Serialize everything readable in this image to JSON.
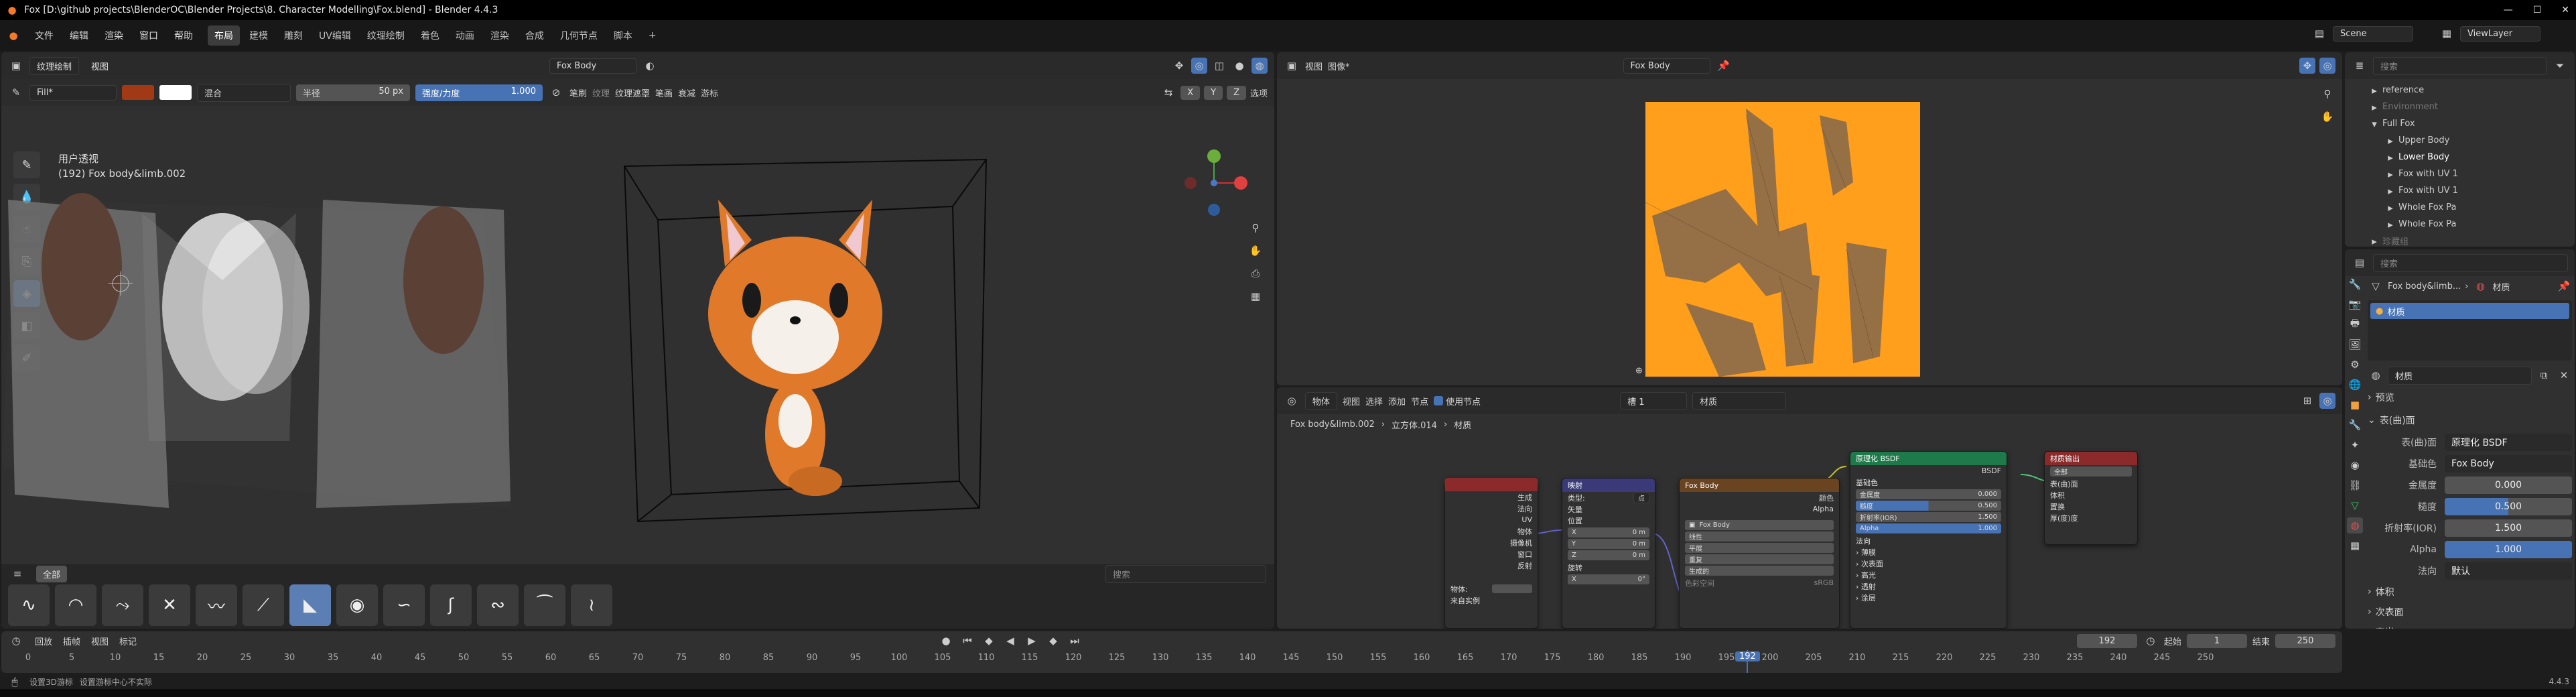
{
  "titlebar": {
    "title": "Fox [D:\\github projects\\BlenderOC\\Blender Projects\\8. Character Modelling\\Fox.blend] - Blender 4.4.3"
  },
  "menu": {
    "items": [
      "文件",
      "编辑",
      "渲染",
      "窗口",
      "帮助"
    ]
  },
  "workspaces": {
    "tabs": [
      "布局",
      "建模",
      "雕刻",
      "UV编辑",
      "纹理绘制",
      "着色",
      "动画",
      "渲染",
      "合成",
      "几何节点",
      "脚本"
    ],
    "active": "布局"
  },
  "top_right": {
    "scene": "Scene",
    "view_layer": "ViewLayer"
  },
  "viewport": {
    "header": {
      "mode": "纹理绘制",
      "view": "视图",
      "object": "Fox Body",
      "menus": [
        "纹理遮罩",
        "笔画",
        "衰减",
        "游标"
      ],
      "options": "选项"
    },
    "toolsettings": {
      "brush": "Fill*",
      "blend": "混合",
      "radius_label": "半径",
      "radius": "50 px",
      "strength_label": "强度/力度",
      "strength": "1.000",
      "brush_menu": "笔刷",
      "texture_menu": "纹理"
    },
    "overlay_text": {
      "view_name": "用户透视",
      "object_info": "(192) Fox body&limb.002"
    },
    "axes": [
      "X",
      "Y",
      "Z"
    ],
    "asset_shelf": {
      "tab": "全部",
      "search_placeholder": "搜索"
    },
    "object_label": "物体:",
    "object_value": "物体",
    "fix_label": "未自实例"
  },
  "image_editor": {
    "menus": [
      "视图",
      "图像*"
    ],
    "image": "Fox Body"
  },
  "node_editor": {
    "header": {
      "type": "物体",
      "menus": [
        "视图",
        "选择",
        "添加",
        "节点"
      ],
      "use_nodes": "使用节点",
      "slot": "槽 1",
      "material": "材质"
    },
    "breadcrumb": [
      "Fox body&limb.002",
      "立方体.014",
      "材质"
    ],
    "nodes": {
      "texcoord": {
        "title": "纹理坐标",
        "outputs": [
          "生成",
          "法向",
          "UV",
          "物体",
          "摄像机",
          "窗口",
          "反射"
        ],
        "object_label": "物体:",
        "instancer": "来自实例"
      },
      "mapping": {
        "title": "映射",
        "type_label": "类型:",
        "type_value": "点",
        "inputs": [
          "矢量",
          "位置",
          "X",
          "Y",
          "Z",
          "旋转",
          "X"
        ],
        "values": [
          "0 m",
          "0 m",
          "0 m",
          "0°"
        ]
      },
      "image": {
        "title": "Fox Body",
        "outputs": [
          "颜色",
          "Alpha"
        ],
        "image_name": "Fox Body",
        "options": [
          "线性",
          "平展",
          "重复",
          "生成的"
        ],
        "colorspace_label": "色彩空间",
        "colorspace": "sRGB"
      },
      "bsdf": {
        "title": "原理化 BSDF",
        "output": "BSDF",
        "base_color": "基础色",
        "rows": [
          {
            "label": "金属度",
            "value": "0.000"
          },
          {
            "label": "糙度",
            "value": "0.500"
          },
          {
            "label": "折射率(IOR)",
            "value": "1.500"
          },
          {
            "label": "Alpha",
            "value": "1.000"
          }
        ],
        "normal": "法向",
        "sections": [
          "次表面",
          "高光",
          "透射",
          "涂层"
        ],
        "extra": "薄膜"
      },
      "output": {
        "title": "材质输出",
        "target": "全部",
        "inputs": [
          "表(曲)面",
          "体积",
          "置换",
          "厚(度)度"
        ]
      }
    }
  },
  "outliner": {
    "items": [
      {
        "label": "reference",
        "indent": 1
      },
      {
        "label": "Environment",
        "indent": 1
      },
      {
        "label": "Full Fox",
        "indent": 1
      },
      {
        "label": "Upper Body",
        "indent": 2
      },
      {
        "label": "Lower Body",
        "indent": 2
      },
      {
        "label": "Fox with UV 1",
        "indent": 2
      },
      {
        "label": "Fox with UV 1",
        "indent": 2
      },
      {
        "label": "Whole Fox Pa",
        "indent": 2
      },
      {
        "label": "Whole Fox Pa",
        "indent": 2
      },
      {
        "label": "珍藏组",
        "indent": 1
      }
    ],
    "search_placeholder": "搜索"
  },
  "properties": {
    "search_placeholder": "搜索",
    "breadcrumb_object": "Fox body&limb...",
    "breadcrumb_tab": "材质",
    "material_slot": "材质",
    "material_name": "材质",
    "sections": {
      "preview": "预览",
      "surface": "表(曲)面",
      "volume": "体积",
      "subsurface": "次表面",
      "specular": "高光"
    },
    "surface": {
      "label": "表(曲)面",
      "value": "原理化 BSDF"
    },
    "rows": [
      {
        "label": "基础色",
        "value": "Fox Body"
      },
      {
        "label": "金属度",
        "value": "0.000"
      },
      {
        "label": "糙度",
        "value": "0.500"
      },
      {
        "label": "折射率(IOR)",
        "value": "1.500"
      },
      {
        "label": "Alpha",
        "value": "1.000"
      },
      {
        "label": "法向",
        "value": "默认"
      }
    ]
  },
  "timeline": {
    "menus": [
      "回放",
      "插帧",
      "视图",
      "标记"
    ],
    "current_frame": "192",
    "start_label": "起始",
    "start": "1",
    "end_label": "结束",
    "end": "250",
    "ticks": [
      "0",
      "5",
      "10",
      "15",
      "20",
      "25",
      "30",
      "35",
      "40",
      "45",
      "50",
      "55",
      "60",
      "65",
      "70",
      "75",
      "80",
      "85",
      "90",
      "95",
      "100",
      "105",
      "110",
      "115",
      "120",
      "125",
      "130",
      "135",
      "140",
      "145",
      "150",
      "155",
      "160",
      "165",
      "170",
      "175",
      "180",
      "185",
      "190",
      "195",
      "200",
      "205",
      "210",
      "215",
      "220",
      "225",
      "230",
      "235",
      "240",
      "245",
      "250"
    ]
  },
  "statusbar": {
    "hint": "设置3D游标",
    "hint2": "设置游标中心不实际",
    "version": "4.4.3"
  },
  "colors": {
    "accent_blue": "#4772b3",
    "orange_texture": "#ff9f1c",
    "fox_orange": "#e07a2a",
    "node_teal": "#1e7a4a",
    "node_red": "#8a2a2a",
    "node_purple": "#3a3a78",
    "node_brown": "#6a4420"
  }
}
